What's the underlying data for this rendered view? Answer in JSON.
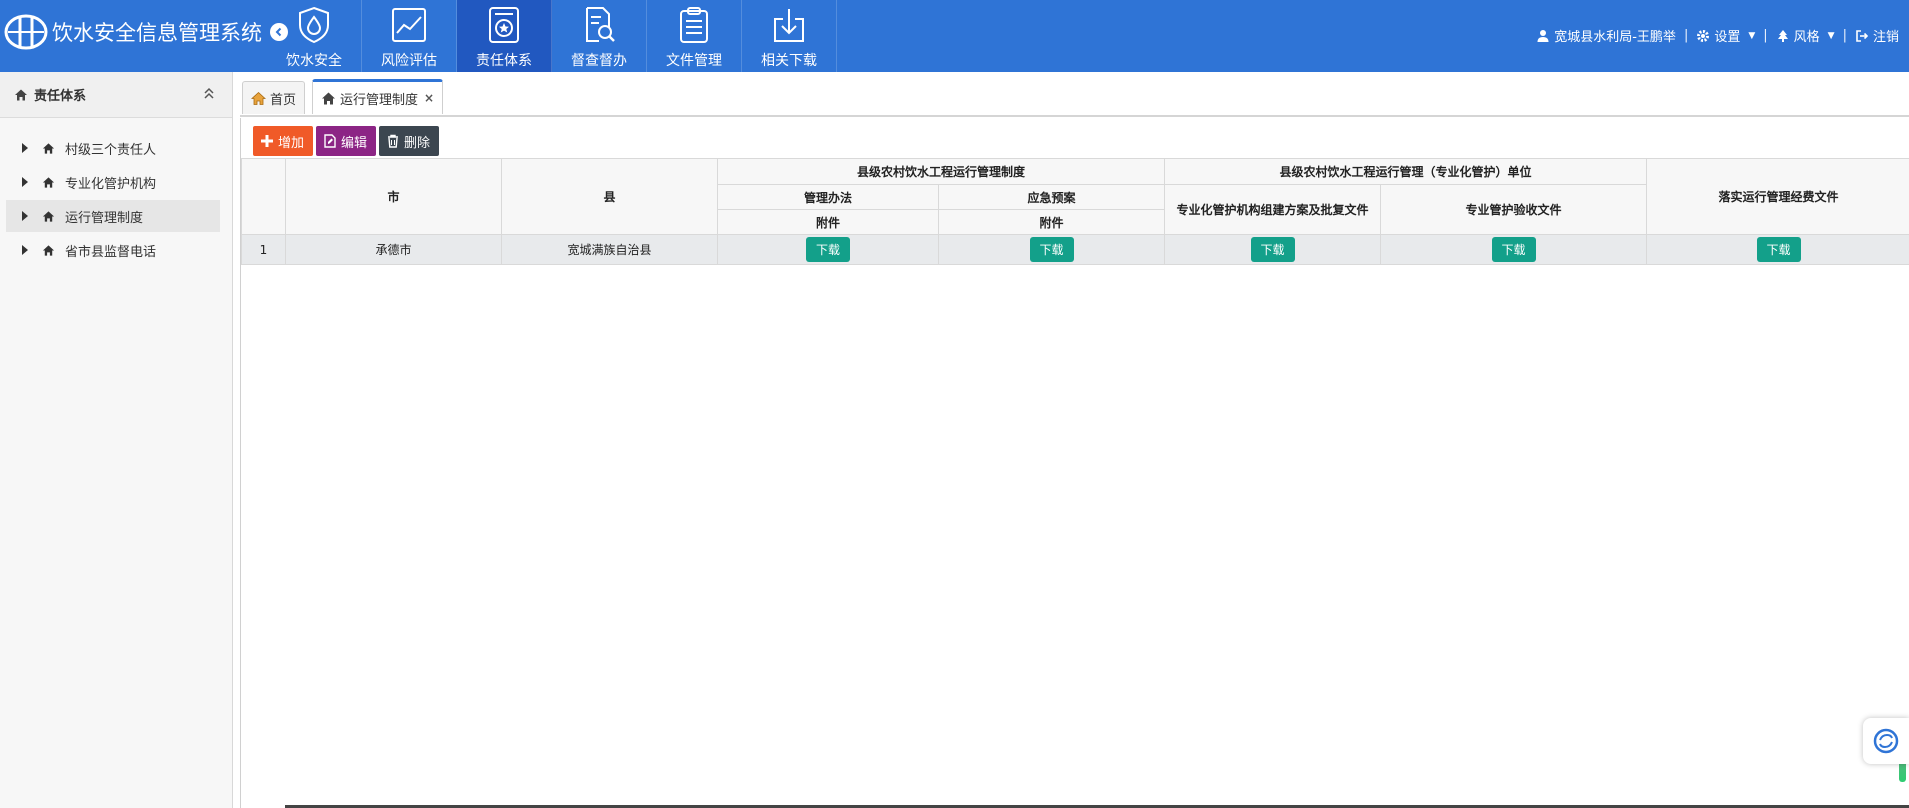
{
  "app": {
    "title": "饮水安全信息管理系统"
  },
  "nav": [
    {
      "label": "饮水安全",
      "icon": "water-drop-shield-icon"
    },
    {
      "label": "风险评估",
      "icon": "line-chart-icon"
    },
    {
      "label": "责任体系",
      "icon": "medal-badge-icon",
      "active": true
    },
    {
      "label": "督查督办",
      "icon": "document-search-icon"
    },
    {
      "label": "文件管理",
      "icon": "clipboard-icon"
    },
    {
      "label": "相关下载",
      "icon": "download-icon"
    }
  ],
  "userbar": {
    "user": "宽城县水利局-王鹏举",
    "settings": "设置",
    "style": "风格",
    "logout": "注销"
  },
  "sidebar": {
    "title": "责任体系",
    "items": [
      {
        "label": "村级三个责任人"
      },
      {
        "label": "专业化管护机构"
      },
      {
        "label": "运行管理制度",
        "active": true
      },
      {
        "label": "省市县监督电话"
      }
    ]
  },
  "tabs": [
    {
      "label": "首页"
    },
    {
      "label": "运行管理制度",
      "close": "×",
      "active": true
    }
  ],
  "toolbar": {
    "add": "增加",
    "edit": "编辑",
    "delete": "删除"
  },
  "table": {
    "headers": {
      "city": "市",
      "county": "县",
      "group1": "县级农村饮水工程运行管理制度",
      "group2": "县级农村饮水工程运行管理（专业化管护）单位",
      "funding": "落实运行管理经费文件",
      "mgmt": "管理办法",
      "emergency": "应急预案",
      "attach1": "附件",
      "attach2": "附件",
      "org_plan": "专业化管护机构组建方案及批复文件",
      "acceptance": "专业管护验收文件"
    },
    "rows": [
      {
        "index": "1",
        "city": "承德市",
        "county": "宽城满族自治县",
        "download": "下载"
      }
    ]
  },
  "colors": {
    "topbar": "#2f74d6",
    "nav_active": "#2158c0",
    "add": "#f05a28",
    "edit": "#8c2585",
    "delete": "#3c4650",
    "download": "#13a08a"
  }
}
